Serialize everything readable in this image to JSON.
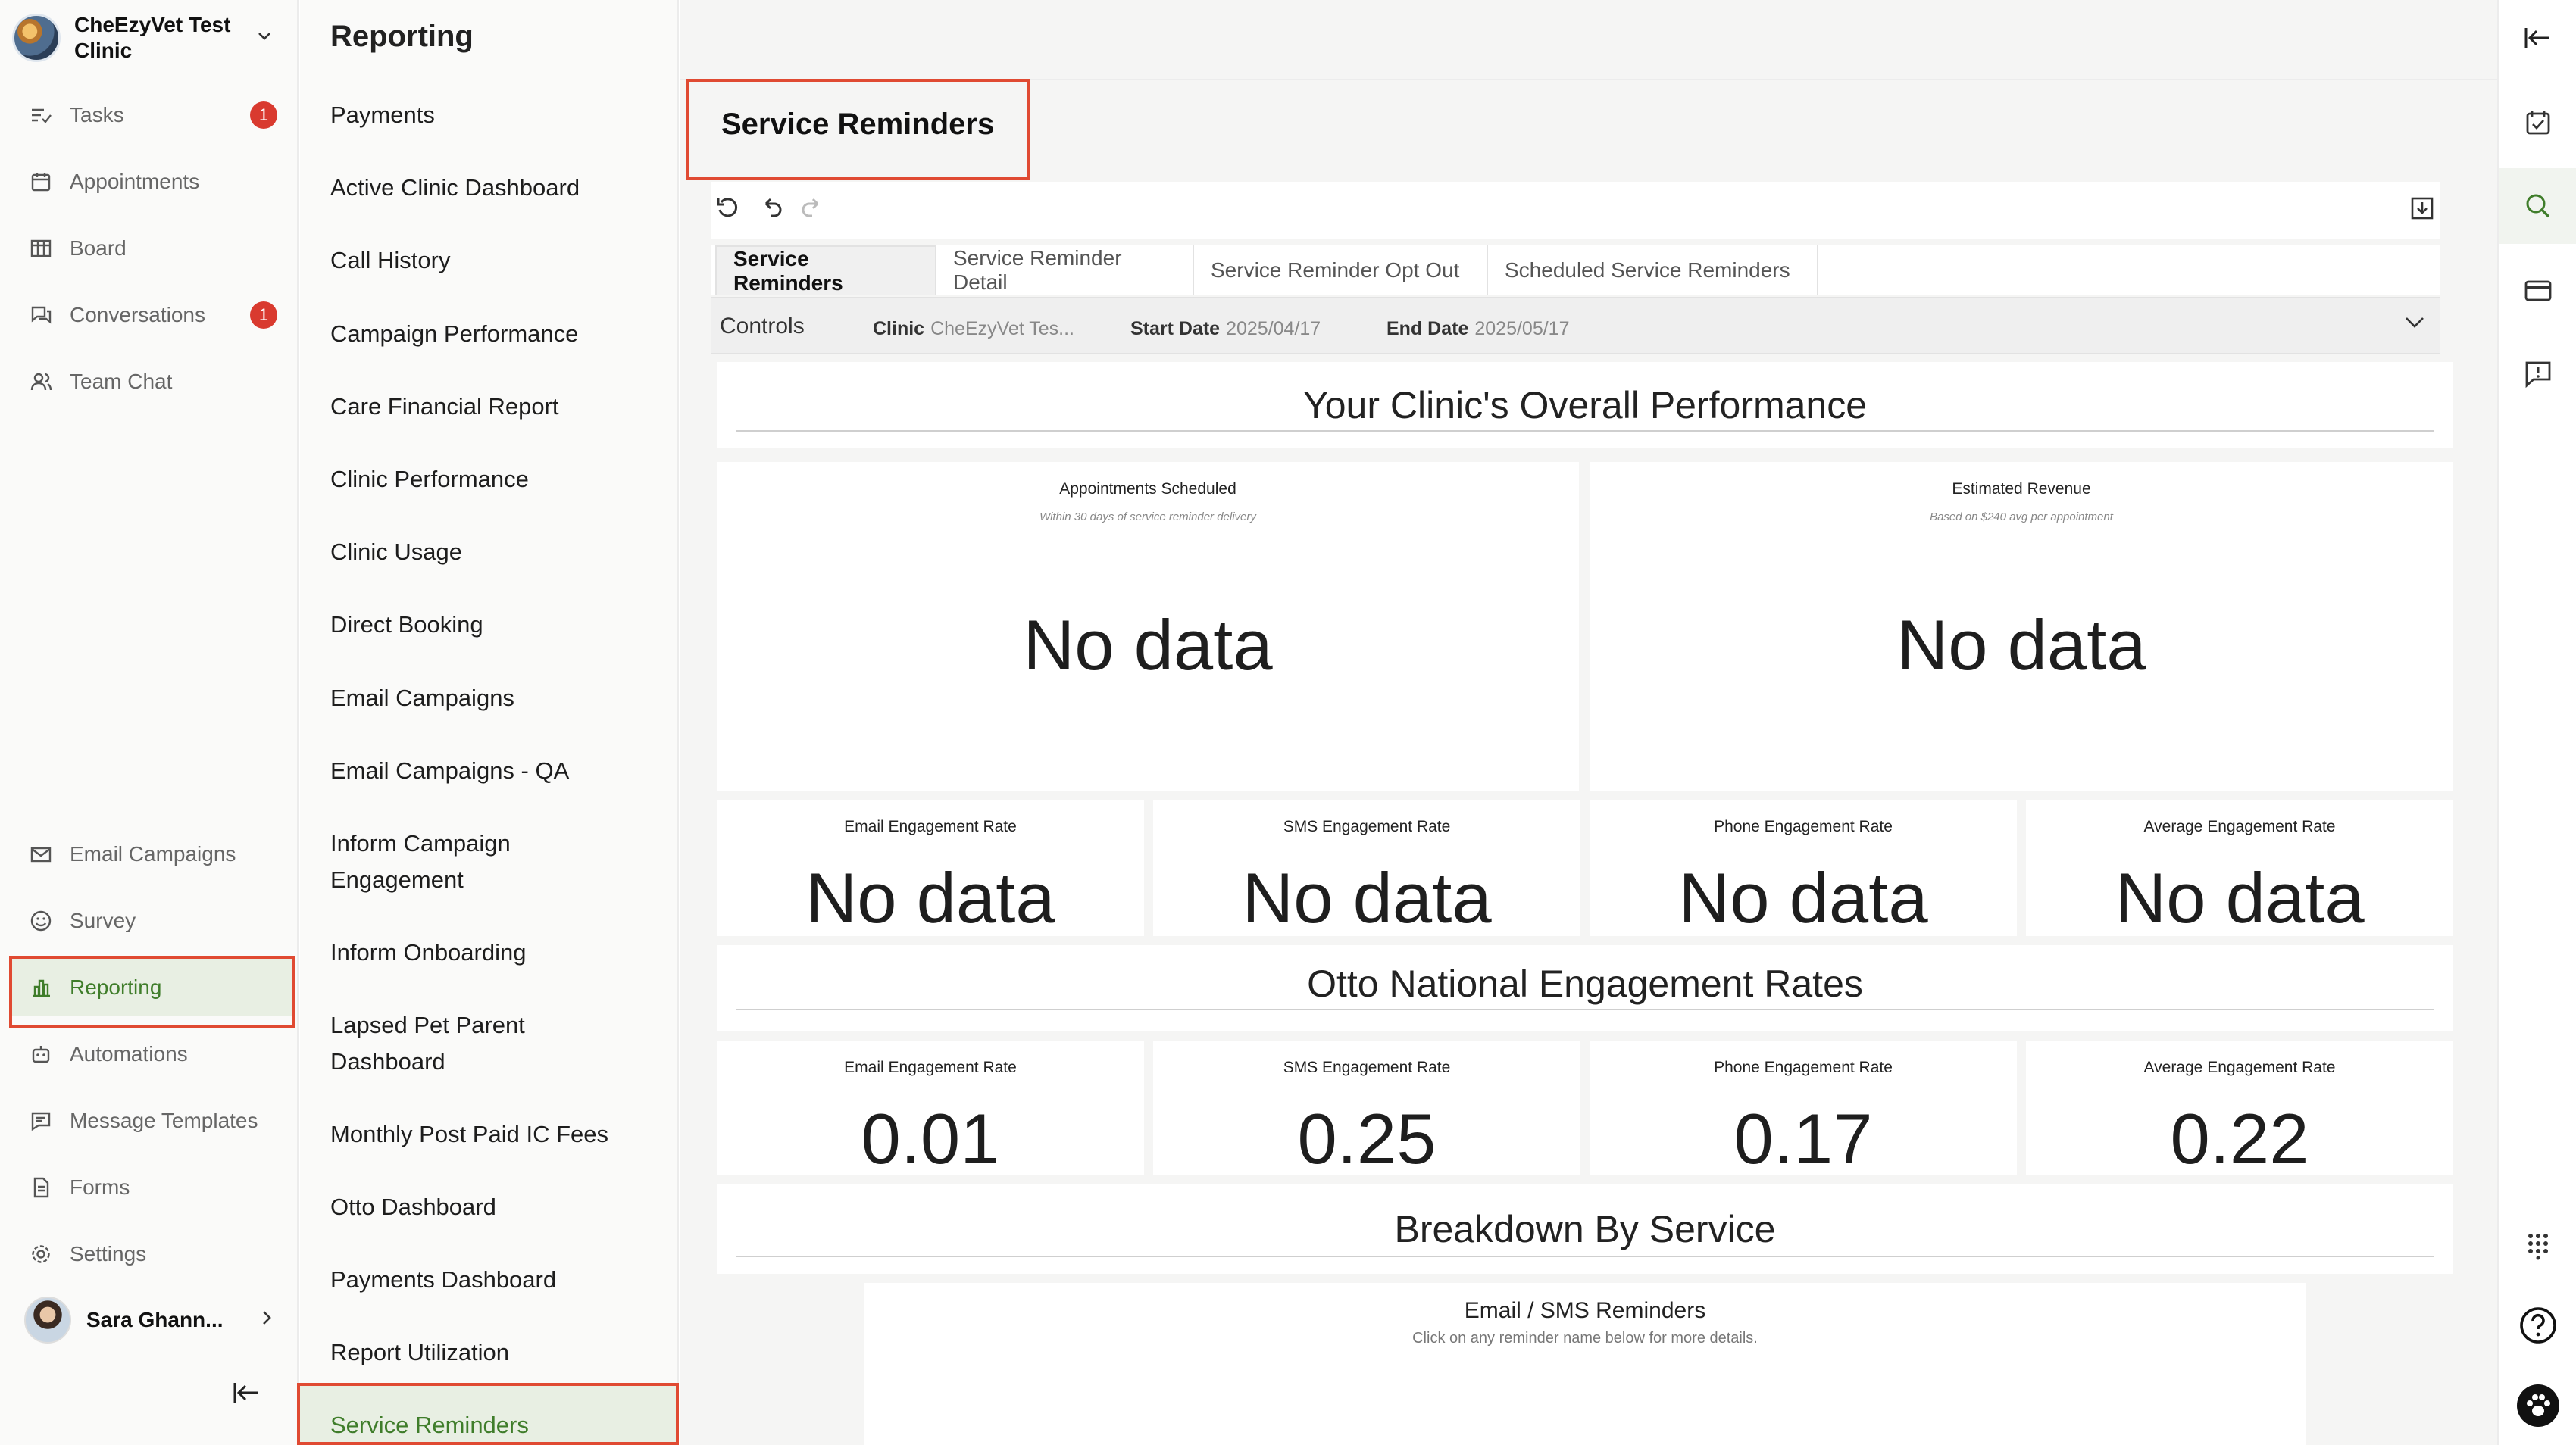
{
  "clinic": {
    "name": "CheEzyVet Test Clinic"
  },
  "nav": {
    "top_items": [
      {
        "label": "Tasks",
        "icon": "tasks-icon",
        "badge": "1"
      },
      {
        "label": "Appointments",
        "icon": "calendar-icon"
      },
      {
        "label": "Board",
        "icon": "board-icon"
      },
      {
        "label": "Conversations",
        "icon": "chat-icon",
        "badge": "1"
      },
      {
        "label": "Team Chat",
        "icon": "team-icon"
      }
    ],
    "bottom_items": [
      {
        "label": "Email Campaigns",
        "icon": "mail-icon"
      },
      {
        "label": "Survey",
        "icon": "smile-icon"
      },
      {
        "label": "Reporting",
        "icon": "bar-chart-icon",
        "active": true
      },
      {
        "label": "Automations",
        "icon": "robot-icon"
      },
      {
        "label": "Message Templates",
        "icon": "message-template-icon"
      },
      {
        "label": "Forms",
        "icon": "document-icon"
      },
      {
        "label": "Settings",
        "icon": "gear-icon"
      }
    ],
    "user_name": "Sara Ghann..."
  },
  "reports": {
    "title": "Reporting",
    "items": [
      "Payments",
      "Active Clinic Dashboard",
      "Call History",
      "Campaign Performance",
      "Care Financial Report",
      "Clinic Performance",
      "Clinic Usage",
      "Direct Booking",
      "Email Campaigns",
      "Email Campaigns - QA",
      "Inform Campaign Engagement",
      "Inform Onboarding",
      "Lapsed Pet Parent Dashboard",
      "Monthly Post Paid IC Fees",
      "Otto Dashboard",
      "Payments Dashboard",
      "Report Utilization",
      "Service Reminders"
    ],
    "selected": "Service Reminders"
  },
  "main": {
    "title": "Service Reminders",
    "tabs": [
      "Service Reminders",
      "Service Reminder Detail",
      "Service Reminder Opt Out",
      "Scheduled Service Reminders"
    ],
    "controls": {
      "label": "Controls",
      "clinic_label": "Clinic",
      "clinic_value": "CheEzyVet Tes...",
      "start_label": "Start Date",
      "start_value": "2025/04/17",
      "end_label": "End Date",
      "end_value": "2025/05/17"
    },
    "overall_title": "Your Clinic's Overall Performance",
    "appointments": {
      "label": "Appointments Scheduled",
      "sub": "Within 30 days of service reminder delivery",
      "value": "No data"
    },
    "revenue": {
      "label": "Estimated Revenue",
      "sub": "Based on $240 avg per appointment",
      "value": "No data"
    },
    "clinic_rates": [
      {
        "label": "Email Engagement Rate",
        "value": "No data"
      },
      {
        "label": "SMS Engagement Rate",
        "value": "No data"
      },
      {
        "label": "Phone Engagement Rate",
        "value": "No data"
      },
      {
        "label": "Average Engagement Rate",
        "value": "No data"
      }
    ],
    "national_title": "Otto National Engagement Rates",
    "national_rates": [
      {
        "label": "Email Engagement Rate",
        "value": "0.01"
      },
      {
        "label": "SMS Engagement Rate",
        "value": "0.25"
      },
      {
        "label": "Phone Engagement Rate",
        "value": "0.17"
      },
      {
        "label": "Average Engagement Rate",
        "value": "0.22"
      }
    ],
    "breakdown_title": "Breakdown By Service",
    "breakdown_card": {
      "title": "Email / SMS Reminders",
      "sub": "Click on any reminder name below for more details."
    }
  },
  "colors": {
    "accent": "#3f7d2a",
    "highlight_box": "#e04a32",
    "badge": "#d93a2f"
  }
}
